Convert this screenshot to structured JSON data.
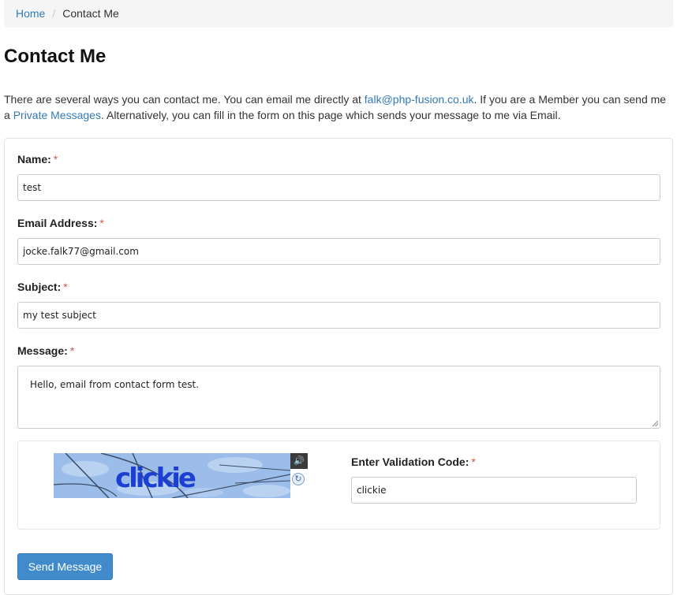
{
  "breadcrumb": {
    "home": "Home",
    "separator": "/",
    "current": "Contact Me"
  },
  "page_title": "Contact Me",
  "intro": {
    "part1": "There are several ways you can contact me. You can email me directly at ",
    "email_link": "falk@php-fusion.co.uk",
    "part2": ". If you are a Member you can send me a ",
    "pm_link": "Private Messages",
    "part3": ". Alternatively, you can fill in the form on this page which sends your message to me via Email."
  },
  "form": {
    "required_mark": "*",
    "name": {
      "label": "Name:",
      "value": "test"
    },
    "email": {
      "label": "Email Address:",
      "value": "jocke.falk77@gmail.com"
    },
    "subject": {
      "label": "Subject:",
      "value": "my test subject"
    },
    "message": {
      "label": "Message:",
      "value": "Hello, email from contact form test."
    },
    "captcha": {
      "image_text": "clickie",
      "audio_icon": "speaker-icon",
      "refresh_icon": "refresh-icon",
      "label": "Enter Validation Code:",
      "value": "clickie"
    },
    "submit_label": "Send Message"
  },
  "colors": {
    "link": "#337ab7",
    "required": "#d9534f",
    "button": "#428bca"
  }
}
